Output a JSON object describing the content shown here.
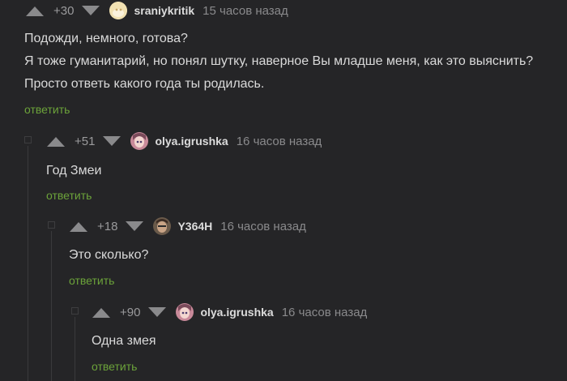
{
  "colors": {
    "background": "#252527",
    "reply": "#6ca33a",
    "meta": "#8a8a8c"
  },
  "comments": [
    {
      "rating": "+30",
      "author": "sraniykritik",
      "time": "15 часов назад",
      "avatar": "default-avatar",
      "lines": [
        "Подожди, немного, готова?",
        "Я тоже гуманитарий, но понял шутку, наверное Вы младше меня, как это выяснить?",
        "Просто ответь какого года ты родилась."
      ],
      "reply_label": "ответить"
    },
    {
      "rating": "+51",
      "author": "olya.igrushka",
      "time": "16 часов назад",
      "avatar": "doll-avatar",
      "lines": [
        "Год Змеи"
      ],
      "reply_label": "ответить"
    },
    {
      "rating": "+18",
      "author": "Y364H",
      "time": "16 часов назад",
      "avatar": "man-avatar",
      "lines": [
        "Это сколько?"
      ],
      "reply_label": "ответить"
    },
    {
      "rating": "+90",
      "author": "olya.igrushka",
      "time": "16 часов назад",
      "avatar": "doll-avatar",
      "lines": [
        "Одна змея"
      ],
      "reply_label": "ответить"
    }
  ]
}
